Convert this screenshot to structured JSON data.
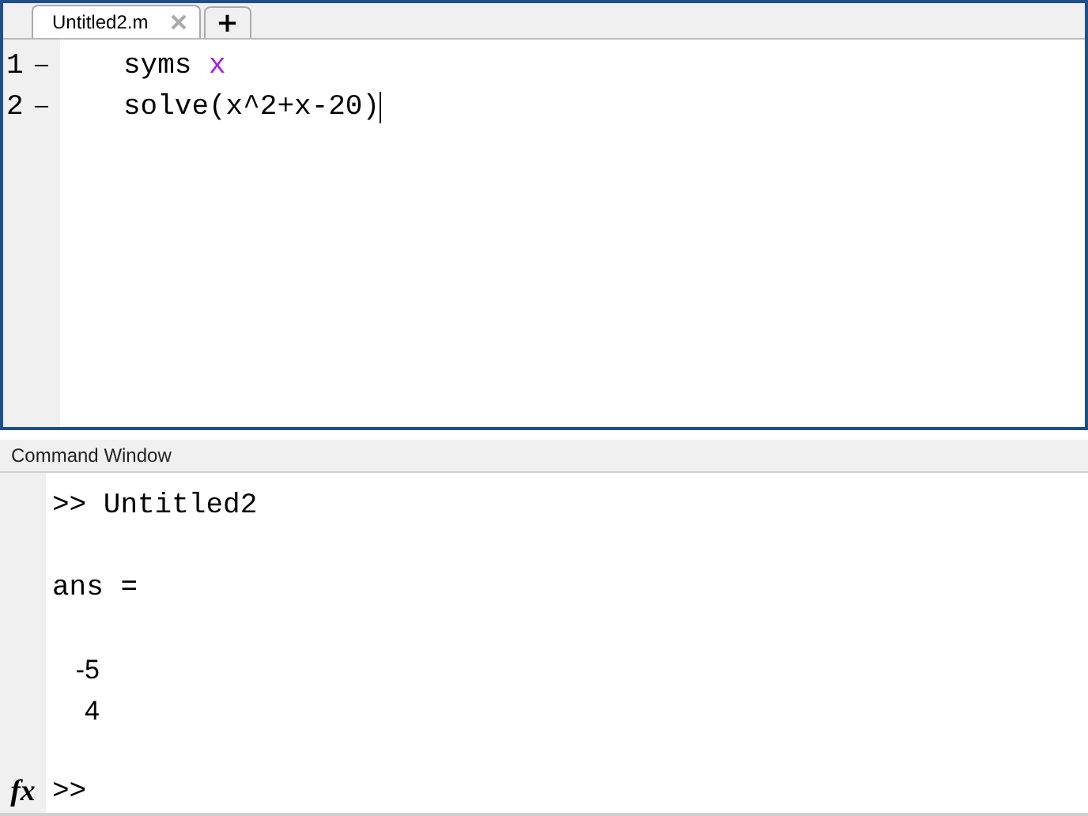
{
  "editor": {
    "tabs": [
      {
        "label": "Untitled2.m",
        "selected": true
      }
    ],
    "new_tab": "+",
    "lines": [
      {
        "number": "1",
        "marker": "—",
        "tokens": [
          {
            "text": "syms ",
            "kind": "code"
          },
          {
            "text": "x",
            "kind": "string"
          }
        ],
        "cursor": false
      },
      {
        "number": "2",
        "marker": "—",
        "tokens": [
          {
            "text": "solve(x^2+x-20)",
            "kind": "code"
          }
        ],
        "cursor": true
      }
    ]
  },
  "command_window": {
    "title": "Command Window",
    "lines": [
      {
        "text": ">> Untitled2",
        "kind": "code"
      },
      {
        "kind": "blank"
      },
      {
        "text": "ans =",
        "kind": "code"
      },
      {
        "kind": "blank"
      },
      {
        "text": "-5",
        "kind": "number"
      },
      {
        "text": "4",
        "kind": "number"
      }
    ],
    "fx": "fx",
    "prompt": ">>"
  }
}
